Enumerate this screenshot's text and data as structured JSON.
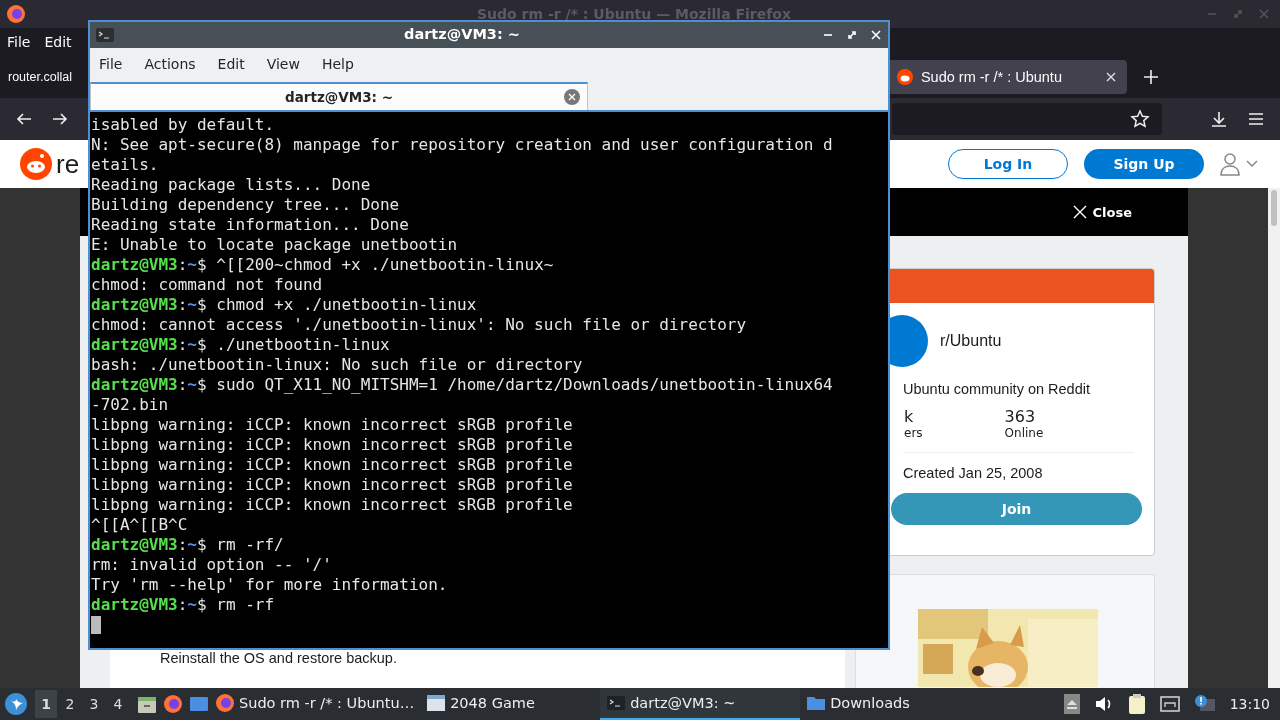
{
  "firefox": {
    "title": "Sudo rm -r /* : Ubuntu — Mozilla Firefox",
    "menu": [
      "File",
      "Edit"
    ],
    "tabs": [
      {
        "title": "router.collal",
        "selected": false
      },
      {
        "title": "Sudo rm -r /* : Ubuntu",
        "selected": true
      }
    ],
    "reddit": {
      "logo_text": "re",
      "login": "Log In",
      "signup": "Sign Up",
      "close": "Close",
      "post_text": "Reinstall the OS and restore backup.",
      "community": {
        "name": "r/Ubuntu",
        "description": "Ubuntu community on Reddit",
        "stats": [
          {
            "value": "k",
            "label": "ers"
          },
          {
            "value": "363",
            "label": "Online"
          }
        ],
        "created": "Created Jan 25, 2008",
        "join": "Join"
      }
    }
  },
  "terminal": {
    "title": "dartz@VM3: ~",
    "menu": [
      "File",
      "Actions",
      "Edit",
      "View",
      "Help"
    ],
    "tabs": [
      {
        "title": "dartz@VM3: ~",
        "selected": true
      }
    ],
    "lines": [
      {
        "kind": "output",
        "text": "isabled by default."
      },
      {
        "kind": "output",
        "text": "N: See apt-secure(8) manpage for repository creation and user configuration d"
      },
      {
        "kind": "output",
        "text": "etails."
      },
      {
        "kind": "output",
        "text": "Reading package lists... Done"
      },
      {
        "kind": "output",
        "text": "Building dependency tree... Done"
      },
      {
        "kind": "output",
        "text": "Reading state information... Done"
      },
      {
        "kind": "output",
        "text": "E: Unable to locate package unetbootin"
      },
      {
        "kind": "prompt",
        "host": "dartz@VM3",
        "sep": ":",
        "path": "~",
        "command": "$ ^[[200~chmod +x ./unetbootin-linux~"
      },
      {
        "kind": "output",
        "text": "chmod: command not found"
      },
      {
        "kind": "prompt",
        "host": "dartz@VM3",
        "sep": ":",
        "path": "~",
        "command": "$ chmod +x ./unetbootin-linux"
      },
      {
        "kind": "output",
        "text": "chmod: cannot access './unetbootin-linux': No such file or directory"
      },
      {
        "kind": "prompt",
        "host": "dartz@VM3",
        "sep": ":",
        "path": "~",
        "command": "$ ./unetbootin-linux"
      },
      {
        "kind": "output",
        "text": "bash: ./unetbootin-linux: No such file or directory"
      },
      {
        "kind": "prompt",
        "host": "dartz@VM3",
        "sep": ":",
        "path": "~",
        "command": "$ sudo QT_X11_NO_MITSHM=1 /home/dartz/Downloads/unetbootin-linux64"
      },
      {
        "kind": "output",
        "text": "-702.bin"
      },
      {
        "kind": "output",
        "text": "libpng warning: iCCP: known incorrect sRGB profile"
      },
      {
        "kind": "output",
        "text": "libpng warning: iCCP: known incorrect sRGB profile"
      },
      {
        "kind": "output",
        "text": "libpng warning: iCCP: known incorrect sRGB profile"
      },
      {
        "kind": "output",
        "text": "libpng warning: iCCP: known incorrect sRGB profile"
      },
      {
        "kind": "output",
        "text": "libpng warning: iCCP: known incorrect sRGB profile"
      },
      {
        "kind": "output",
        "text": "^[[A^[[B^C"
      },
      {
        "kind": "prompt",
        "host": "dartz@VM3",
        "sep": ":",
        "path": "~",
        "command": "$ rm -rf/"
      },
      {
        "kind": "output",
        "text": "rm: invalid option -- '/'"
      },
      {
        "kind": "output",
        "text": "Try 'rm --help' for more information."
      },
      {
        "kind": "prompt",
        "host": "dartz@VM3",
        "sep": ":",
        "path": "~",
        "command": "$ rm -rf"
      }
    ]
  },
  "taskbar": {
    "workspaces": [
      {
        "label": "1",
        "selected": true
      },
      {
        "label": "2",
        "selected": false
      },
      {
        "label": "3",
        "selected": false
      },
      {
        "label": "4",
        "selected": false
      }
    ],
    "tasks": [
      {
        "kind": "firefox",
        "title": "Sudo rm -r /* : Ubuntu…",
        "selected": false
      },
      {
        "kind": "window",
        "title": "2048 Game",
        "selected": false
      },
      {
        "kind": "terminal",
        "title": "dartz@VM3: ~",
        "selected": true
      },
      {
        "kind": "folder",
        "title": "Downloads",
        "selected": false
      }
    ],
    "clock": "13:10"
  }
}
